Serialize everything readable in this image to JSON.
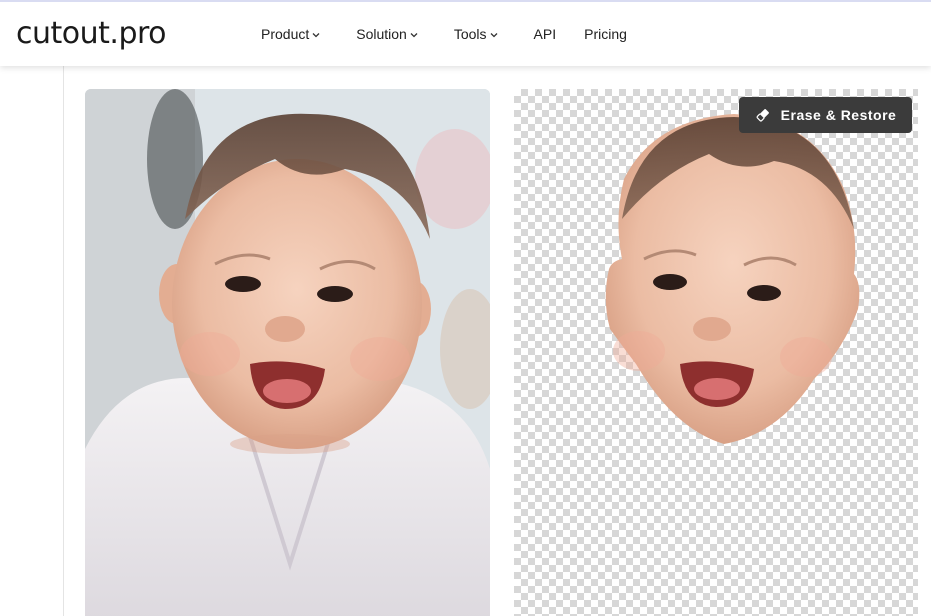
{
  "header": {
    "logo_text": "cutout.pro",
    "nav": [
      {
        "label": "Product",
        "has_dropdown": true
      },
      {
        "label": "Solution",
        "has_dropdown": true
      },
      {
        "label": "Tools",
        "has_dropdown": true
      },
      {
        "label": "API",
        "has_dropdown": false
      },
      {
        "label": "Pricing",
        "has_dropdown": false
      }
    ]
  },
  "editor": {
    "erase_restore_label": "Erase & Restore",
    "erase_icon": "eraser-icon",
    "original_image": "baby-photo",
    "result_image": "baby-face-cutout-on-transparent-background"
  },
  "colors": {
    "header_bg": "#ffffff",
    "header_top_border": "#d9dcf2",
    "button_bg": "#3b3b3b",
    "button_text": "#ffffff",
    "checker_light": "#ffffff",
    "checker_dark": "#d7d7d7"
  }
}
